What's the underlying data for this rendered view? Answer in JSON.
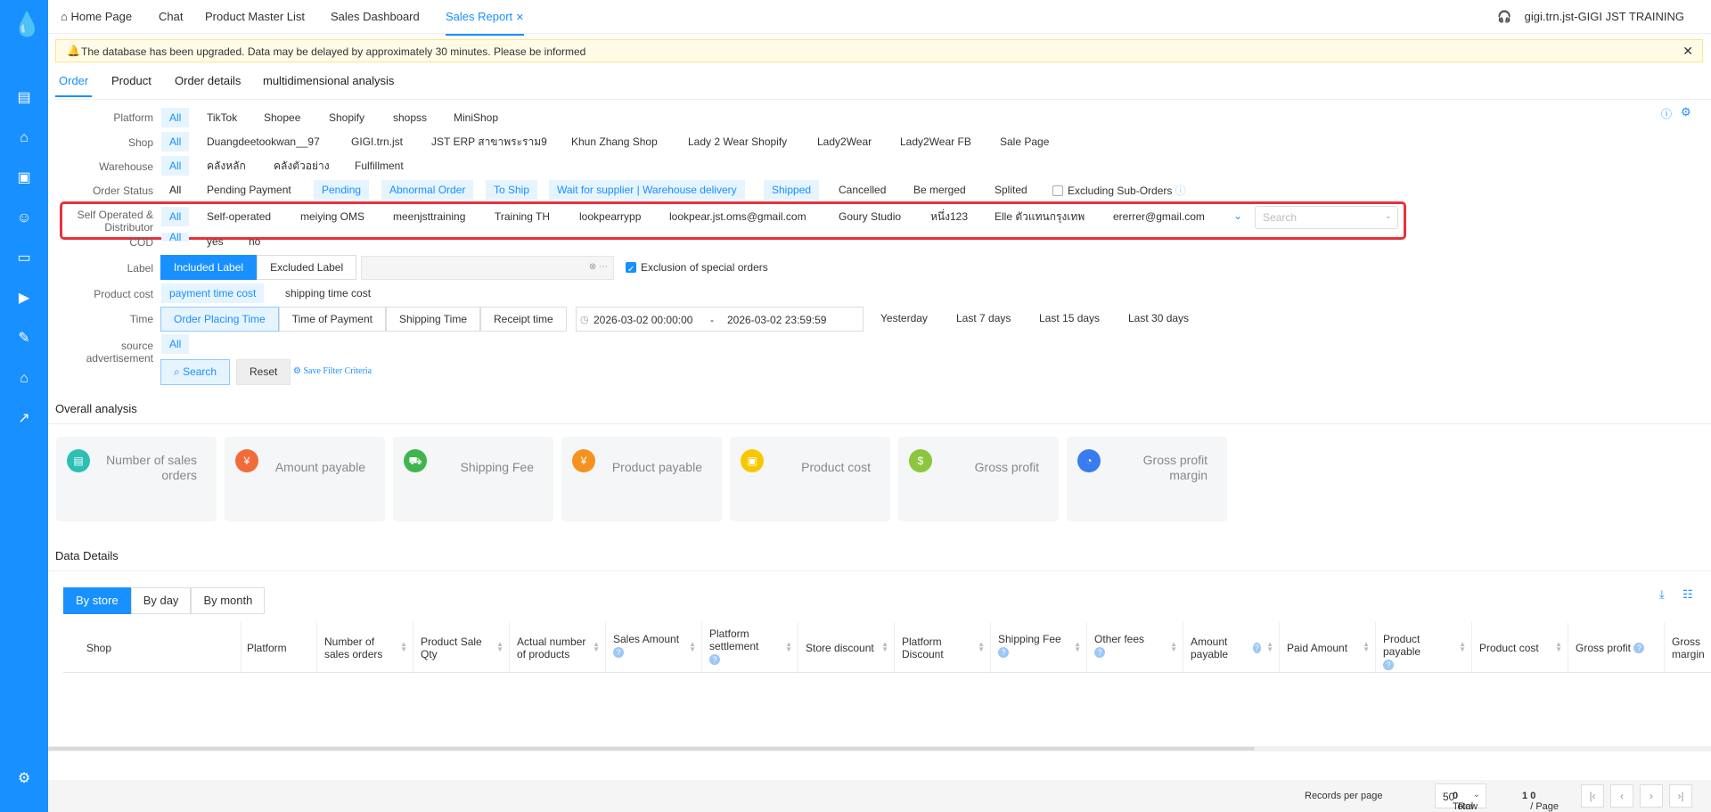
{
  "app": {
    "brand_color": "#1890ff",
    "logo_icon": "water-drop-icon"
  },
  "sidebar": {
    "icons": [
      "document-icon",
      "home-icon",
      "bag-icon",
      "user-icon",
      "card-icon",
      "video-icon",
      "edit-icon",
      "store-icon",
      "chart-icon"
    ],
    "settings_icon": "gear-icon"
  },
  "topbar": {
    "tabs": [
      "Home Page",
      "Chat",
      "Product Master List",
      "Sales Dashboard",
      "Sales Report"
    ],
    "active_tab": "Sales Report",
    "user": "gigi.trn.jst-GIGI JST TRAINING"
  },
  "notice": {
    "text": "The database has been upgraded. Data may be delayed by approximately 30 minutes. Please be informed"
  },
  "subtabs": [
    "Order",
    "Product",
    "Order details",
    "multidimensional analysis"
  ],
  "filters": {
    "platform": {
      "label": "Platform",
      "options": [
        "All",
        "TikTok",
        "Shopee",
        "Shopify",
        "shopss",
        "MiniShop"
      ]
    },
    "shop": {
      "label": "Shop",
      "options": [
        "All",
        "Duangdeetookwan__97",
        "GIGI.trn.jst",
        "JST ERP สาขาพระราม9",
        "Khun Zhang Shop",
        "Lady 2 Wear Shopify",
        "Lady2Wear",
        "Lady2Wear FB",
        "Sale Page"
      ]
    },
    "warehouse": {
      "label": "Warehouse",
      "options": [
        "All",
        "คลังหลัก",
        "คลังตัวอย่าง",
        "Fulfillment"
      ]
    },
    "order_status": {
      "label": "Order Status",
      "options": [
        "All",
        "Pending Payment",
        "Pending",
        "Abnormal Order",
        "To Ship",
        "Wait for supplier | Warehouse delivery",
        "Shipped",
        "Cancelled",
        "Be merged",
        "Splited"
      ],
      "excluding_sub_orders": "Excluding Sub-Orders"
    },
    "self_operated": {
      "label_line1": "Self Operated &",
      "label_line2": "Distributor",
      "options": [
        "All",
        "Self-operated",
        "meiying OMS",
        "meenjsttraining",
        "Training TH",
        "lookpearrypp",
        "lookpear.jst.oms@gmail.com",
        "Goury Studio",
        "หนึ่ง123",
        "Elle ตัวแทนกรุงเทพ",
        "ererrer@gmail.com"
      ],
      "search_placeholder": "Search"
    },
    "cod": {
      "label": "COD",
      "options": [
        "All",
        "yes",
        "no"
      ]
    },
    "label": {
      "label": "Label",
      "included": "Included Label",
      "excluded": "Excluded Label",
      "exclusion_special": "Exclusion of special orders"
    },
    "product_cost": {
      "label": "Product cost",
      "options": [
        "payment time cost",
        "shipping time cost"
      ]
    },
    "time": {
      "label": "Time",
      "modes": [
        "Order Placing Time",
        "Time of Payment",
        "Shipping Time",
        "Receipt time"
      ],
      "start": "2026-03-02 00:00:00",
      "sep": "-",
      "end": "2026-03-02 23:59:59",
      "quick": [
        "Yesterday",
        "Last 7 days",
        "Last 15 days",
        "Last 30 days"
      ]
    },
    "source": {
      "label_line1": "source",
      "label_line2": "advertisement",
      "options": [
        "All"
      ]
    },
    "actions": {
      "search": "Search",
      "reset": "Reset",
      "save": "Save Filter Criteria"
    }
  },
  "overall": {
    "title": "Overall analysis",
    "cards": [
      {
        "label": "Number of sales orders",
        "color": "#2bc0b4",
        "icon": "order-icon"
      },
      {
        "label": "Amount payable",
        "color": "#f26b3a",
        "icon": "payable-icon"
      },
      {
        "label": "Shipping Fee",
        "color": "#3fb54e",
        "icon": "truck-icon"
      },
      {
        "label": "Product payable",
        "color": "#f5921e",
        "icon": "product-icon"
      },
      {
        "label": "Product cost",
        "color": "#f7c800",
        "icon": "cost-icon"
      },
      {
        "label": "Gross profit",
        "color": "#8cc63f",
        "icon": "profit-icon"
      },
      {
        "label": "Gross profit margin",
        "color": "#3a7bef",
        "icon": "margin-icon"
      }
    ]
  },
  "details": {
    "title": "Data Details",
    "view_tabs": [
      "By store",
      "By day",
      "By month"
    ],
    "columns": [
      "Shop",
      "Platform",
      "Number of sales orders",
      "Product Sale Qty",
      "Actual number of products",
      "Sales Amount",
      "Platform settlement",
      "Store discount",
      "Platform Discount",
      "Shipping Fee",
      "Other fees",
      "Amount payable",
      "Paid Amount",
      "Product payable",
      "Product cost",
      "Gross profit",
      "Gross margin"
    ]
  },
  "footer": {
    "records_per_page": "Records per page",
    "per_page": "50",
    "total": "Total",
    "total_count": "0",
    "row": "Row",
    "page_cur": "1",
    "page_sep": "/",
    "page_total": "0",
    "page": "Page"
  }
}
